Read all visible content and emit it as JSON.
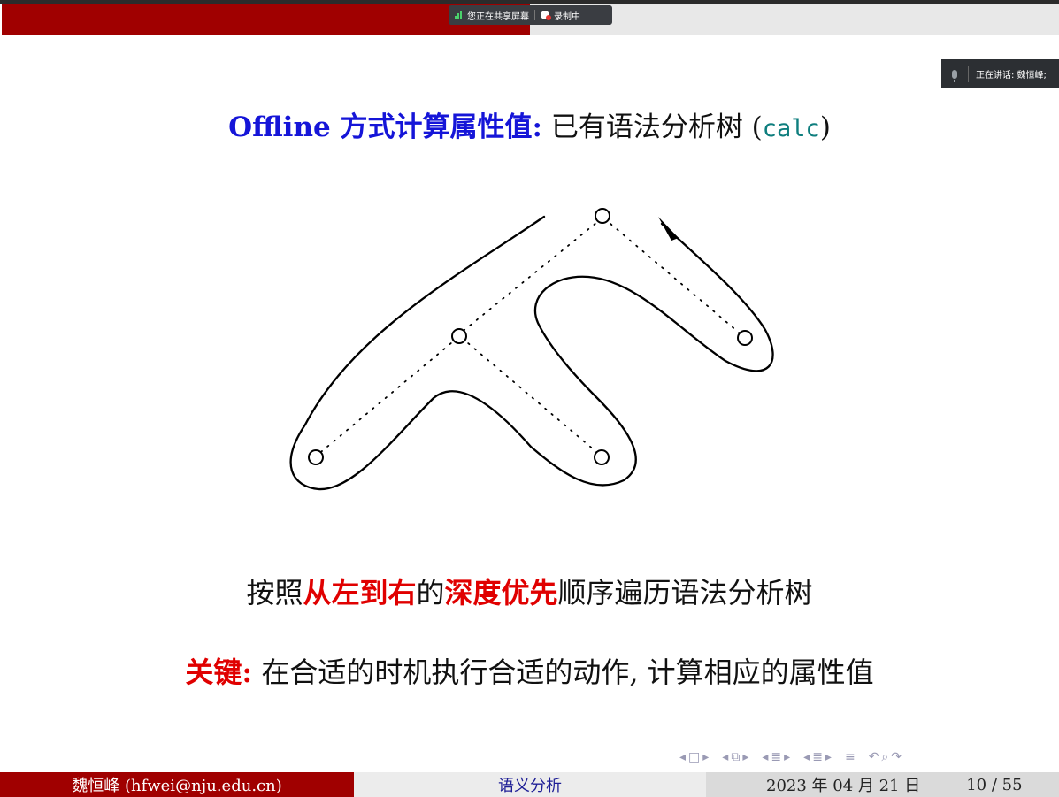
{
  "share_bar": {
    "sharing_label": "您正在共享屏幕",
    "recording_label": "录制中"
  },
  "speaker_badge": {
    "label": "正在讲话: 魏恒峰;"
  },
  "slide": {
    "title_bold": "Offline 方式计算属性值:",
    "title_normal": " 已有语法分析树 (",
    "title_code": "calc",
    "title_close": ")",
    "line1": [
      "按照",
      "从左到右",
      "的",
      "深度优先",
      "顺序遍历语法分析树"
    ],
    "line2_key": "关键:",
    "line2_rest": " 在合适的时机执行合适的动作, 计算相应的属性值"
  },
  "footer": {
    "author": "魏恒峰 (hfwei@nju.edu.cn)",
    "title": "语义分析",
    "date": "2023 年 04 月 21 日",
    "page": "10 / 55"
  },
  "colors": {
    "beamer_red": "#a00000",
    "title_blue": "#1515d8",
    "emphasis_red": "#e00000",
    "code_teal": "#0e7e7e"
  }
}
